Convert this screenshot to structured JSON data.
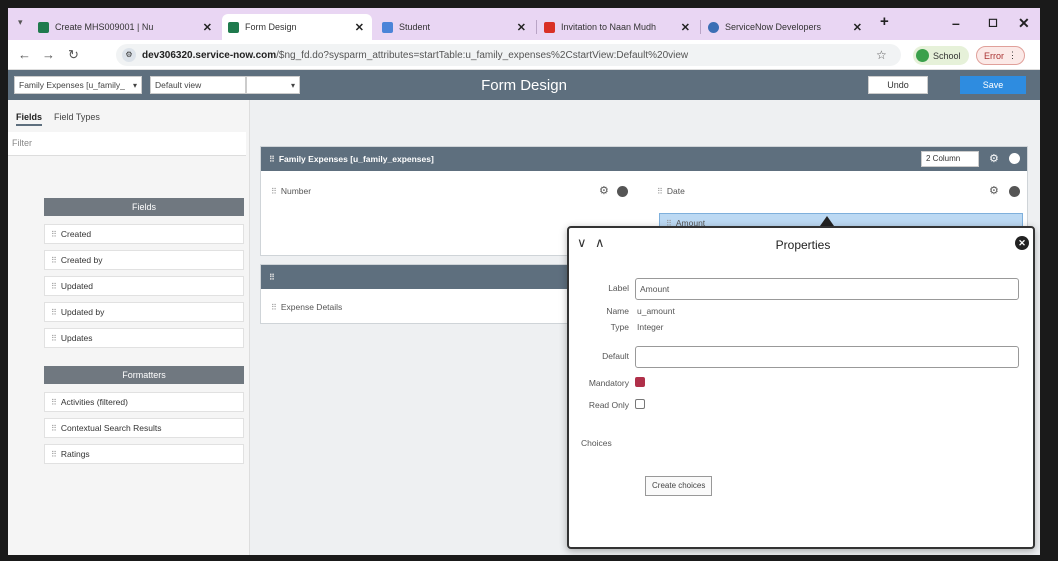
{
  "browser": {
    "tabs": [
      {
        "label": "Create MHS009001 | Nu",
        "active": false,
        "color": "#1f7a4d"
      },
      {
        "label": "Form Design",
        "active": true,
        "color": "#1f7a4d"
      },
      {
        "label": "Student",
        "active": false,
        "color": "#4b84d8"
      },
      {
        "label": "Invitation to Naan Mudh",
        "active": false,
        "color": "#d93025"
      },
      {
        "label": "ServiceNow Developers",
        "active": false,
        "color": "#3b6fb5"
      }
    ],
    "new_tab": "+",
    "minimize": "–",
    "maximize": "◻",
    "close": "✕",
    "url_host": "dev306320.service-now.com",
    "url_path": "/$ng_fd.do?sysparm_attributes=startTable:u_family_expenses%2CstartView:Default%20view",
    "profile_label": "School",
    "error_label": "Error"
  },
  "app": {
    "table_select": "Family Expenses [u_family_",
    "view_select": "Default view",
    "blank_select": "",
    "title": "Form Design",
    "undo_label": "Undo",
    "save_label": "Save"
  },
  "left_panel": {
    "tab_fields": "Fields",
    "tab_field_types": "Field Types",
    "filter_placeholder": "Filter",
    "fields_header": "Fields",
    "fields": [
      "Created",
      "Created by",
      "Updated",
      "Updated by",
      "Updates"
    ],
    "formatters_header": "Formatters",
    "formatters": [
      "Activities (filtered)",
      "Contextual Search Results",
      "Ratings"
    ]
  },
  "canvas": {
    "section1_title": "Family Expenses [u_family_expenses]",
    "columns_select": "2 Column",
    "field_number": "Number",
    "field_date": "Date",
    "field_amount": "Amount",
    "section2_title": "",
    "field_expense_details": "Expense Details"
  },
  "properties": {
    "title": "Properties",
    "label_label": "Label",
    "label_value": "Amount",
    "name_label": "Name",
    "name_value": "u_amount",
    "type_label": "Type",
    "type_value": "Integer",
    "default_label": "Default",
    "default_value": "",
    "mandatory_label": "Mandatory",
    "mandatory_checked": true,
    "read_only_label": "Read Only",
    "read_only_checked": false,
    "choices_label": "Choices",
    "create_choices_label": "Create choices"
  }
}
